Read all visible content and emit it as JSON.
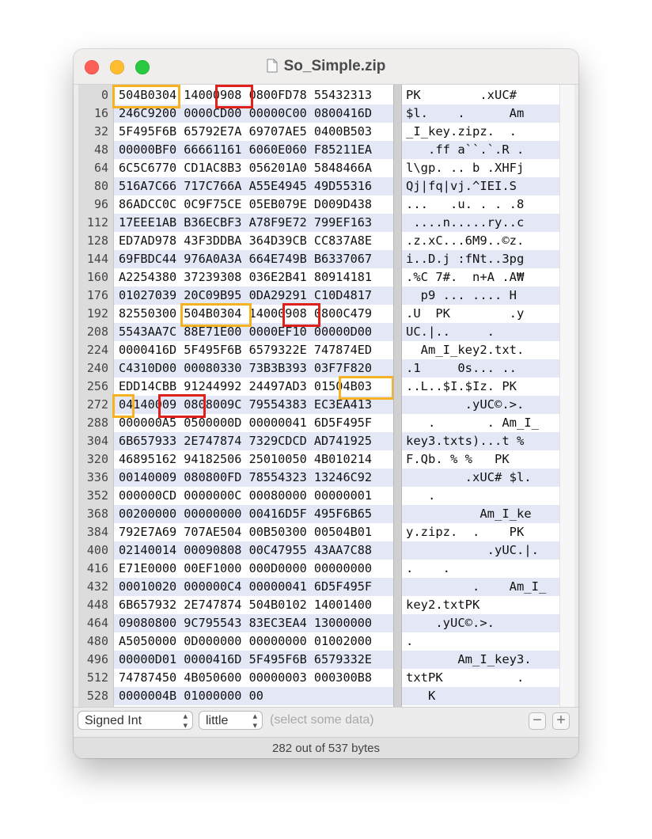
{
  "window": {
    "title": "So_Simple.zip",
    "doc_icon": "document-icon",
    "traffic_lights": [
      "#fe5f57",
      "#febc2e",
      "#28c840"
    ]
  },
  "highlight_colors": {
    "orange": "#f5b324",
    "red": "#e0201a"
  },
  "rows": [
    {
      "off": "0",
      "hex": "504B0304 14000908 0800FD78 55432313",
      "ascii": "PK        .xUC#"
    },
    {
      "off": "16",
      "hex": "246C9200 0000CD00 00000C00 0800416D",
      "ascii": "$l.    .      Am"
    },
    {
      "off": "32",
      "hex": "5F495F6B 65792E7A 69707AE5 0400B503",
      "ascii": "_I_key.zipz.  . "
    },
    {
      "off": "48",
      "hex": "00000BF0 66661161 6060E060 F85211EA",
      "ascii": "   .ff a``.`.R ."
    },
    {
      "off": "64",
      "hex": "6C5C6770 CD1AC8B3 056201A0 5848466A",
      "ascii": "l\\gp. .. b .XHFj"
    },
    {
      "off": "80",
      "hex": "516A7C66 717C766A A55E4945 49D55316",
      "ascii": "Qj|fq|vj.^IEI.S "
    },
    {
      "off": "96",
      "hex": "86ADCC0C 0C9F75CE 05EB079E D009D438",
      "ascii": "...   .u. . . .8"
    },
    {
      "off": "112",
      "hex": "17EEE1AB B36ECBF3 A78F9E72 799EF163",
      "ascii": " ....n.....ry..c"
    },
    {
      "off": "128",
      "hex": "ED7AD978 43F3DDBA 364D39CB CC837A8E",
      "ascii": ".z.xC...6M9..©z."
    },
    {
      "off": "144",
      "hex": "69FBDC44 976A0A3A 664E749B B6337067",
      "ascii": "i..D.j :fNt..3pg"
    },
    {
      "off": "160",
      "hex": "A2254380 37239308 036E2B41 80914181",
      "ascii": ".%C 7#.  n+A .A₩"
    },
    {
      "off": "176",
      "hex": "01027039 20C09B95 0DA29291 C10D4817",
      "ascii": "  p9 ... .... H "
    },
    {
      "off": "192",
      "hex": "82550300 504B0304 14000908 0800C479",
      "ascii": ".U  PK        .y"
    },
    {
      "off": "208",
      "hex": "5543AA7C 88E71E00 0000EF10 00000D00",
      "ascii": "UC.|..     .    "
    },
    {
      "off": "224",
      "hex": "0000416D 5F495F6B 6579322E 747874ED",
      "ascii": "  Am_I_key2.txt."
    },
    {
      "off": "240",
      "hex": "C4310D00 00080330 73B3B393 03F7F820",
      "ascii": ".1     0s... .. "
    },
    {
      "off": "256",
      "hex": "EDD14CBB 91244992 24497AD3 01504B03",
      "ascii": "..L..$I.$Iz. PK "
    },
    {
      "off": "272",
      "hex": "04140009 0808009C 79554383 EC3EA413",
      "ascii": "        .yUC©.>."
    },
    {
      "off": "288",
      "hex": "000000A5 0500000D 00000041 6D5F495F",
      "ascii": "   .       . Am_I_"
    },
    {
      "off": "304",
      "hex": "6B657933 2E747874 7329CDCD AD741925",
      "ascii": "key3.txts)...t %"
    },
    {
      "off": "320",
      "hex": "46895162 94182506 25010050 4B010214",
      "ascii": "F.Qb. % %   PK  "
    },
    {
      "off": "336",
      "hex": "00140009 080800FD 78554323 13246C92",
      "ascii": "        .xUC# $l."
    },
    {
      "off": "352",
      "hex": "000000CD 0000000C 00080000 00000001",
      "ascii": "   .            "
    },
    {
      "off": "368",
      "hex": "00200000 00000000 00416D5F 495F6B65",
      "ascii": "          Am_I_ke"
    },
    {
      "off": "384",
      "hex": "792E7A69 707AE504 00B50300 00504B01",
      "ascii": "y.zipz.  .    PK "
    },
    {
      "off": "400",
      "hex": "02140014 00090808 00C47955 43AA7C88",
      "ascii": "           .yUC.|."
    },
    {
      "off": "416",
      "hex": "E71E0000 00EF1000 000D0000 00000000",
      "ascii": ".    .          "
    },
    {
      "off": "432",
      "hex": "00010020 000000C4 00000041 6D5F495F",
      "ascii": "         .    Am_I_"
    },
    {
      "off": "448",
      "hex": "6B657932 2E747874 504B0102 14001400",
      "ascii": "key2.txtPK      "
    },
    {
      "off": "464",
      "hex": "09080800 9C795543 83EC3EA4 13000000",
      "ascii": "    .yUC©.>.    "
    },
    {
      "off": "480",
      "hex": "A5050000 0D000000 00000000 01002000",
      "ascii": ".               "
    },
    {
      "off": "496",
      "hex": "00000D01 0000416D 5F495F6B 6579332E",
      "ascii": "       Am_I_key3."
    },
    {
      "off": "512",
      "hex": "74787450 4B050600 00000003 000300B8",
      "ascii": "txtPK          ."
    },
    {
      "off": "528",
      "hex": "0000004B 01000000 00",
      "ascii": "   K"
    }
  ],
  "bottom": {
    "type_select": "Signed Int",
    "endian_select": "little",
    "hint": "(select some data)",
    "minus": "−",
    "plus": "+"
  },
  "status": "282 out of 537 bytes"
}
